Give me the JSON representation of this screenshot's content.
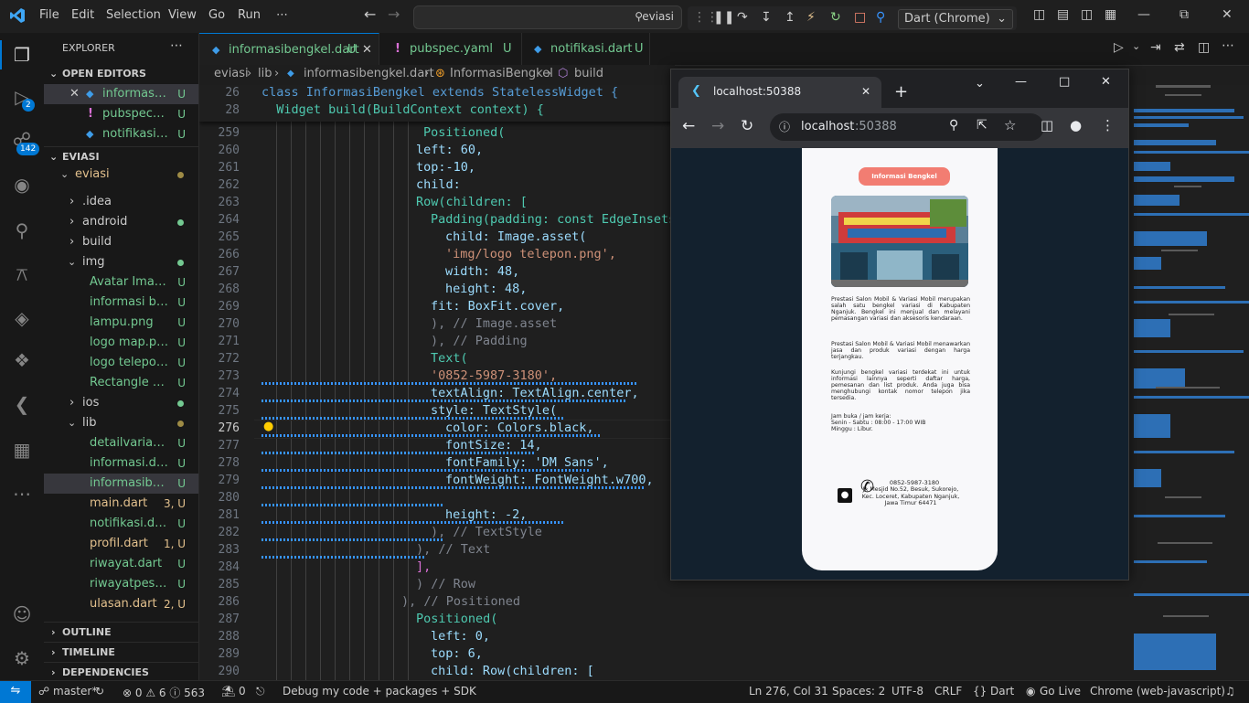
{
  "titlebar": {
    "menu": [
      "File",
      "Edit",
      "Selection",
      "View",
      "Go",
      "Run",
      "⋯"
    ],
    "search_text": "eviasi",
    "debug_target": "Dart (Chrome)"
  },
  "activity": {
    "debug_badge": "2",
    "scm_badge": "142"
  },
  "sidebar": {
    "title": "EXPLORER",
    "open_editors_label": "OPEN EDITORS",
    "open_editors": [
      {
        "name": "informasib...",
        "status": "U"
      },
      {
        "name": "pubspec.ya...",
        "status": "U"
      },
      {
        "name": "notifikasi.d...",
        "status": "U"
      }
    ],
    "workspace_label": "EVIASI",
    "root_folder": "eviasi",
    "tree": [
      {
        "name": ".idea"
      },
      {
        "name": "android"
      },
      {
        "name": "build"
      },
      {
        "name": "img"
      },
      {
        "name": "Avatar Image....",
        "status": "U"
      },
      {
        "name": "informasi ben...",
        "status": "U"
      },
      {
        "name": "lampu.png",
        "status": "U"
      },
      {
        "name": "logo map.png",
        "status": "U"
      },
      {
        "name": "logo telepon....",
        "status": "U"
      },
      {
        "name": "Rectangle 1.p...",
        "status": "U"
      },
      {
        "name": "ios"
      },
      {
        "name": "lib"
      },
      {
        "name": "detailvariasi.d...",
        "status": "U"
      },
      {
        "name": "informasi.dart",
        "status": "U"
      },
      {
        "name": "informasiben...",
        "status": "U"
      },
      {
        "name": "main.dart",
        "status": "3, U"
      },
      {
        "name": "notifikasi.dart",
        "status": "U"
      },
      {
        "name": "profil.dart",
        "status": "1, U"
      },
      {
        "name": "riwayat.dart",
        "status": "U"
      },
      {
        "name": "riwayatpesan...",
        "status": "U"
      },
      {
        "name": "ulasan.dart",
        "status": "2, U"
      }
    ],
    "outline_label": "OUTLINE",
    "timeline_label": "TIMELINE",
    "dependencies_label": "DEPENDENCIES"
  },
  "tabs": [
    {
      "label": "informasibengkel.dart",
      "status": "U"
    },
    {
      "label": "pubspec.yaml",
      "status": "U"
    },
    {
      "label": "notifikasi.dart",
      "status": "U"
    }
  ],
  "breadcrumb": {
    "parts": [
      "eviasi",
      "lib",
      "informasibengkel.dart",
      "InformasiBengkel",
      "build"
    ]
  },
  "editor": {
    "sticky": [
      {
        "num": "26",
        "text": "class InformasiBengkel extends StatelessWidget {"
      },
      {
        "num": "28",
        "text": "  Widget build(BuildContext context) {"
      }
    ],
    "lines": [
      {
        "num": "259",
        "text": "Positioned("
      },
      {
        "num": "260",
        "text": "left: 60,"
      },
      {
        "num": "261",
        "text": "top:-10,"
      },
      {
        "num": "262",
        "text": "child:"
      },
      {
        "num": "263",
        "text": "Row(children: ["
      },
      {
        "num": "264",
        "text": "Padding(padding: const EdgeInsets."
      },
      {
        "num": "265",
        "text": "child: Image.asset("
      },
      {
        "num": "266",
        "text": "'img/logo telepon.png',"
      },
      {
        "num": "267",
        "text": "width: 48,"
      },
      {
        "num": "268",
        "text": "height: 48,"
      },
      {
        "num": "269",
        "text": "fit: BoxFit.cover,"
      },
      {
        "num": "270",
        "text": "), // Image.asset"
      },
      {
        "num": "271",
        "text": "), // Padding"
      },
      {
        "num": "272",
        "text": "Text("
      },
      {
        "num": "273",
        "text": "'0852-5987-3180',"
      },
      {
        "num": "274",
        "text": "textAlign: TextAlign.center,"
      },
      {
        "num": "275",
        "text": "style: TextStyle("
      },
      {
        "num": "276",
        "text": "color: Colors.black,"
      },
      {
        "num": "277",
        "text": "fontSize: 14,"
      },
      {
        "num": "278",
        "text": "fontFamily: 'DM Sans',"
      },
      {
        "num": "279",
        "text": "fontWeight: FontWeight.w700,"
      },
      {
        "num": "280",
        "text": ""
      },
      {
        "num": "281",
        "text": "height: -2,"
      },
      {
        "num": "282",
        "text": "), // TextStyle"
      },
      {
        "num": "283",
        "text": "), // Text"
      },
      {
        "num": "284",
        "text": "],"
      },
      {
        "num": "285",
        "text": ") // Row"
      },
      {
        "num": "286",
        "text": "), // Positioned"
      },
      {
        "num": "287",
        "text": "Positioned("
      },
      {
        "num": "288",
        "text": "left: 0,"
      },
      {
        "num": "289",
        "text": "top: 6,"
      },
      {
        "num": "290",
        "text": "child: Row(children: ["
      }
    ]
  },
  "browser": {
    "tab_title": "localhost:50388",
    "url_host": "localhost",
    "url_port": ":50388",
    "app": {
      "header_button": "Informasi Bengkel",
      "para1": "Prestasi Salon Mobil & Variasi Mobil merupakan salah satu bengkel variasi di Kabupaten Nganjuk. Bengkel ini menjual dan melayani pemasangan variasi dan aksesoris kendaraan.",
      "para2": "Prestasi Salon Mobil & Variasi Mobil menawarkan jasa dan produk variasi dengan harga terjangkau.",
      "para3": "Kunjungi bengkel variasi terdekat ini untuk informasi lainnya seperti daftar harga, pemesanan dan list produk. Anda juga bisa menghubungi kontak nomor telepon jika tersedia.",
      "hours_title": "Jam buka / jam kerja:",
      "hours_weekday": "Senin - Sabtu : 08:00 - 17:00 WIB",
      "hours_sunday": "Minggu : Libur.",
      "phone": "0852-5987-3180",
      "address": "Jl. Mesjid No.52, Besuk, Sukorejo, Kec. Loceret, Kabupaten Nganjuk, Jawa Timur 64471"
    }
  },
  "statusbar": {
    "branch": "master*",
    "problems": "⊗ 0 ⚠ 6 ⓘ 563",
    "ports": "⛱ 0",
    "debug": "Debug my code + packages + SDK",
    "position": "Ln 276, Col 31",
    "spaces": "Spaces: 2",
    "encoding": "UTF-8",
    "eol": "CRLF",
    "language": "Dart",
    "golive": "Go Live",
    "device": "Chrome (web-javascript)"
  }
}
